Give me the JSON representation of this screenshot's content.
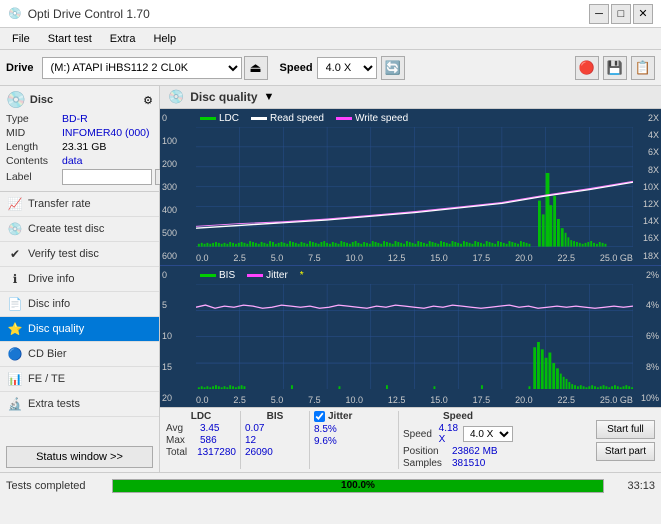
{
  "app": {
    "title": "Opti Drive Control 1.70",
    "icon": "💿"
  },
  "titlebar": {
    "title": "Opti Drive Control 1.70",
    "minimize": "─",
    "maximize": "□",
    "close": "✕"
  },
  "menu": {
    "items": [
      "File",
      "Start test",
      "Extra",
      "Help"
    ]
  },
  "toolbar": {
    "drive_label": "Drive",
    "drive_value": "(M:) ATAPI iHBS112  2 CL0K",
    "speed_label": "Speed",
    "speed_value": "4.0 X"
  },
  "disc": {
    "type_label": "Type",
    "type_value": "BD-R",
    "mid_label": "MID",
    "mid_value": "INFOMER40 (000)",
    "length_label": "Length",
    "length_value": "23.31 GB",
    "contents_label": "Contents",
    "contents_value": "data",
    "label_label": "Label",
    "label_value": ""
  },
  "nav": {
    "items": [
      {
        "id": "transfer-rate",
        "label": "Transfer rate",
        "icon": "📈"
      },
      {
        "id": "create-test-disc",
        "label": "Create test disc",
        "icon": "💿"
      },
      {
        "id": "verify-test-disc",
        "label": "Verify test disc",
        "icon": "✅"
      },
      {
        "id": "drive-info",
        "label": "Drive info",
        "icon": "ℹ"
      },
      {
        "id": "disc-info",
        "label": "Disc info",
        "icon": "📄"
      },
      {
        "id": "disc-quality",
        "label": "Disc quality",
        "icon": "⭐",
        "active": true
      },
      {
        "id": "cd-bier",
        "label": "CD Bier",
        "icon": "🔵"
      },
      {
        "id": "fe-te",
        "label": "FE / TE",
        "icon": "📊"
      },
      {
        "id": "extra-tests",
        "label": "Extra tests",
        "icon": "🔬"
      }
    ]
  },
  "status_window_btn": "Status window >>",
  "disc_quality": {
    "title": "Disc quality",
    "legend": {
      "ldc_label": "LDC",
      "ldc_color": "#00cc00",
      "read_speed_label": "Read speed",
      "read_speed_color": "#ffffff",
      "write_speed_label": "Write speed",
      "write_speed_color": "#ff44ff"
    },
    "chart1": {
      "y_left": [
        "600",
        "500",
        "400",
        "300",
        "200",
        "100",
        "0"
      ],
      "y_right": [
        "18X",
        "16X",
        "14X",
        "12X",
        "10X",
        "8X",
        "6X",
        "4X",
        "2X"
      ],
      "x_labels": [
        "0.0",
        "2.5",
        "5.0",
        "7.5",
        "10.0",
        "12.5",
        "15.0",
        "17.5",
        "20.0",
        "22.5",
        "25.0 GB"
      ]
    },
    "chart2": {
      "legend": {
        "bis_label": "BIS",
        "bis_color": "#00cc00",
        "jitter_label": "Jitter",
        "jitter_color": "#ff44ff"
      },
      "y_left": [
        "20",
        "15",
        "10",
        "5",
        "0"
      ],
      "y_right": [
        "10%",
        "8%",
        "6%",
        "4%",
        "2%"
      ],
      "x_labels": [
        "0.0",
        "2.5",
        "5.0",
        "7.5",
        "10.0",
        "12.5",
        "15.0",
        "17.5",
        "20.0",
        "22.5",
        "25.0 GB"
      ]
    }
  },
  "stats": {
    "ldc_header": "LDC",
    "bis_header": "BIS",
    "jitter_header": "Jitter",
    "jitter_checked": true,
    "speed_header": "Speed",
    "avg_label": "Avg",
    "max_label": "Max",
    "total_label": "Total",
    "ldc_avg": "3.45",
    "ldc_max": "586",
    "ldc_total": "1317280",
    "bis_avg": "0.07",
    "bis_max": "12",
    "bis_total": "26090",
    "jitter_avg": "8.5%",
    "jitter_max": "9.6%",
    "speed_label_text": "Speed",
    "speed_value": "4.18 X",
    "speed_combo_value": "4.0 X",
    "position_label": "Position",
    "position_value": "23862 MB",
    "samples_label": "Samples",
    "samples_value": "381510",
    "start_full_label": "Start full",
    "start_part_label": "Start part"
  },
  "statusbar": {
    "text": "Tests completed",
    "progress_pct": 100,
    "progress_label": "100.0%",
    "time": "33:13"
  },
  "colors": {
    "accent": "#0078d7",
    "chart_bg": "#1a3a5c",
    "grid": "#2a5090",
    "ldc_bar": "#00cc00",
    "read_speed": "#ffffff",
    "write_speed": "#ff44ff",
    "bis_bar": "#00cc00",
    "jitter_line": "#ffaaff"
  }
}
